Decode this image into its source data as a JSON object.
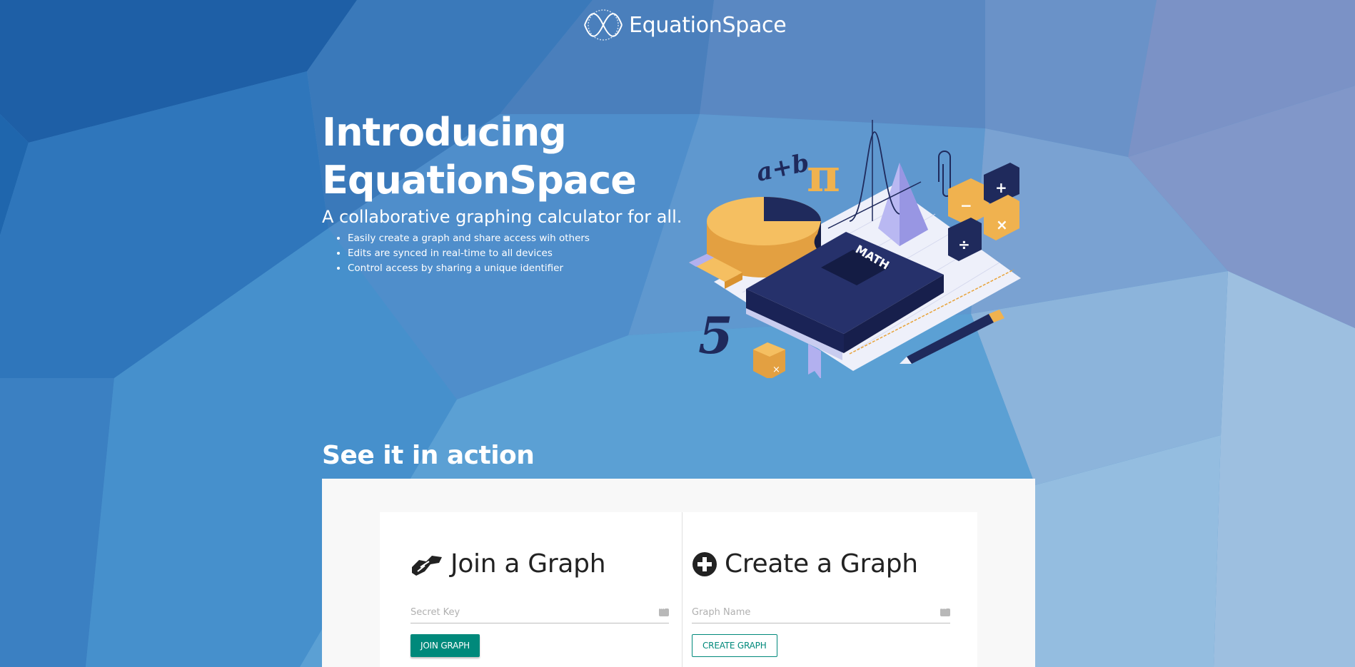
{
  "brand": {
    "name": "EquationSpace"
  },
  "hero": {
    "title_line1": "Introducing",
    "title_line2": "EquationSpace",
    "subtitle": "A collaborative graphing calculator for all.",
    "features": [
      "Easily create a graph and share access wih others",
      "Edits are synced in real-time to all devices",
      "Control access by sharing a unique identifier"
    ]
  },
  "illustration": {
    "labels": {
      "ab": "a+b",
      "pi": "π",
      "math": "MATH",
      "five": "5"
    }
  },
  "demo": {
    "heading": "See it in action",
    "join": {
      "title": "Join a Graph",
      "placeholder": "Secret Key",
      "button": "JOIN GRAPH"
    },
    "create": {
      "title": "Create a Graph",
      "placeholder": "Graph Name",
      "button": "CREATE GRAPH"
    }
  },
  "colors": {
    "accent": "#00897b",
    "navy": "#1f2a5c",
    "gold": "#f0b24f"
  }
}
